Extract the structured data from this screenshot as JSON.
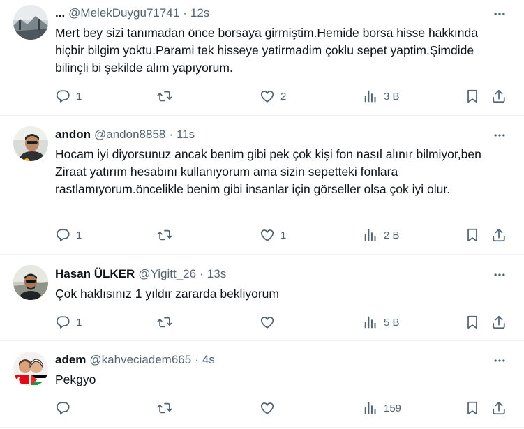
{
  "tweets": [
    {
      "name": "...",
      "handle": "@MelekDuygu71741",
      "separator": "·",
      "time": "12s",
      "text": "Mert bey sizi tanımadan önce borsaya girmiştim.Hemide borsa hisse hakkında hiçbir bilgim yoktu.Parami tek hisseye yatirmadim çoklu sepet yaptim.Şimdide bilinçli bi şekilde alım yapıyorum.",
      "replies": "1",
      "retweets": "",
      "likes": "2",
      "views": "3 B"
    },
    {
      "name": "andon",
      "handle": "@andon8858",
      "separator": "·",
      "time": "11s",
      "text": "Hocam iyi diyorsunuz ancak benim gibi pek çok kişi fon nasıl alınır bilmiyor,ben Ziraat yatırım hesabını kullanıyorum ama sizin sepetteki fonlara rastlamıyorum.öncelikle benim gibi insanlar için görseller olsa çok iyi olur.",
      "replies": "1",
      "retweets": "",
      "likes": "1",
      "views": "2 B"
    },
    {
      "name": "Hasan ÜLKER",
      "handle": "@Yigitt_26",
      "separator": "·",
      "time": "13s",
      "text": "Çok haklısınız 1 yıldır zararda bekliyorum",
      "replies": "1",
      "retweets": "",
      "likes": "",
      "views": "5 B"
    },
    {
      "name": "adem",
      "handle": "@kahveciadem665",
      "separator": "·",
      "time": "4s",
      "text": "Pekgyo",
      "replies": "",
      "retweets": "",
      "likes": "",
      "views": "159"
    }
  ],
  "icons": {
    "more": "more-dots-icon",
    "reply": "reply-icon",
    "retweet": "retweet-icon",
    "like": "heart-icon",
    "views": "views-chart-icon",
    "bookmark": "bookmark-icon",
    "share": "share-icon"
  },
  "colors": {
    "text": "#0f1419",
    "secondary": "#536471",
    "divider": "#eff3f4"
  }
}
